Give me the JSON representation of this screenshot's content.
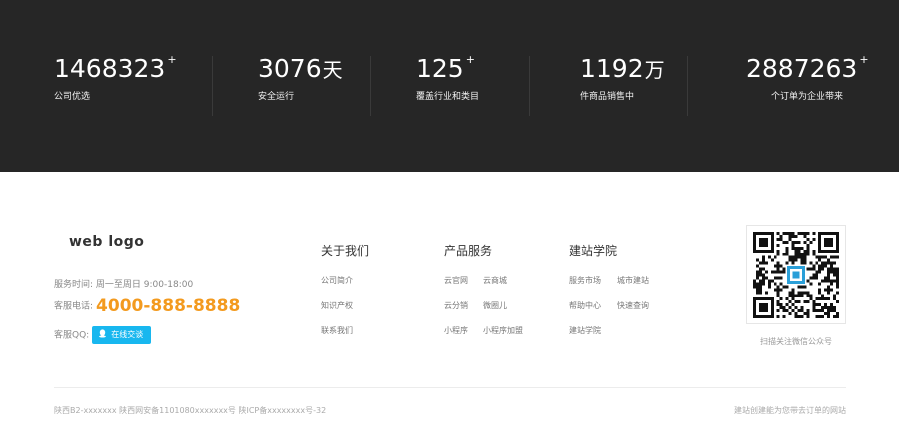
{
  "stats": [
    {
      "number": "1468323",
      "unit": "",
      "sup": "+",
      "label": "公司优选"
    },
    {
      "number": "3076",
      "unit": "天",
      "sup": "",
      "label": "安全运行"
    },
    {
      "number": "125",
      "unit": "",
      "sup": "+",
      "label": "覆盖行业和类目"
    },
    {
      "number": "1192",
      "unit": "万",
      "sup": "",
      "label": "件商品销售中"
    },
    {
      "number": "2887263",
      "unit": "",
      "sup": "+",
      "label": "个订单为企业带来"
    }
  ],
  "footer": {
    "logo": "web logo",
    "hours_label": "服务时间:",
    "hours_value": "周一至周日 9:00-18:00",
    "phone_label": "客服电话:",
    "phone_value": "4000-888-8888",
    "qq_label": "客服QQ:",
    "qq_button": "在线交谈",
    "columns": [
      {
        "title": "关于我们",
        "links": [
          "公司简介",
          "知识产权",
          "联系我们"
        ]
      },
      {
        "title": "产品服务",
        "links": [
          "云官网",
          "云商城",
          "云分销",
          "微圈儿",
          "小程序",
          "小程序加盟"
        ]
      },
      {
        "title": "建站学院",
        "links": [
          "服务市场",
          "城市建站",
          "帮助中心",
          "快速查询",
          "建站学院"
        ]
      }
    ],
    "qr_caption": "扫描关注微信公众号",
    "copyright": "陕西B2-xxxxxxx 陕西网安备1101080xxxxxxx号 陕ICP备xxxxxxxx号-32",
    "slogan": "建站创建能为您带去订单的网站"
  },
  "colors": {
    "stats_bg": "#262626",
    "hotline": "#f39a1e",
    "qq_button": "#18b7ef"
  }
}
